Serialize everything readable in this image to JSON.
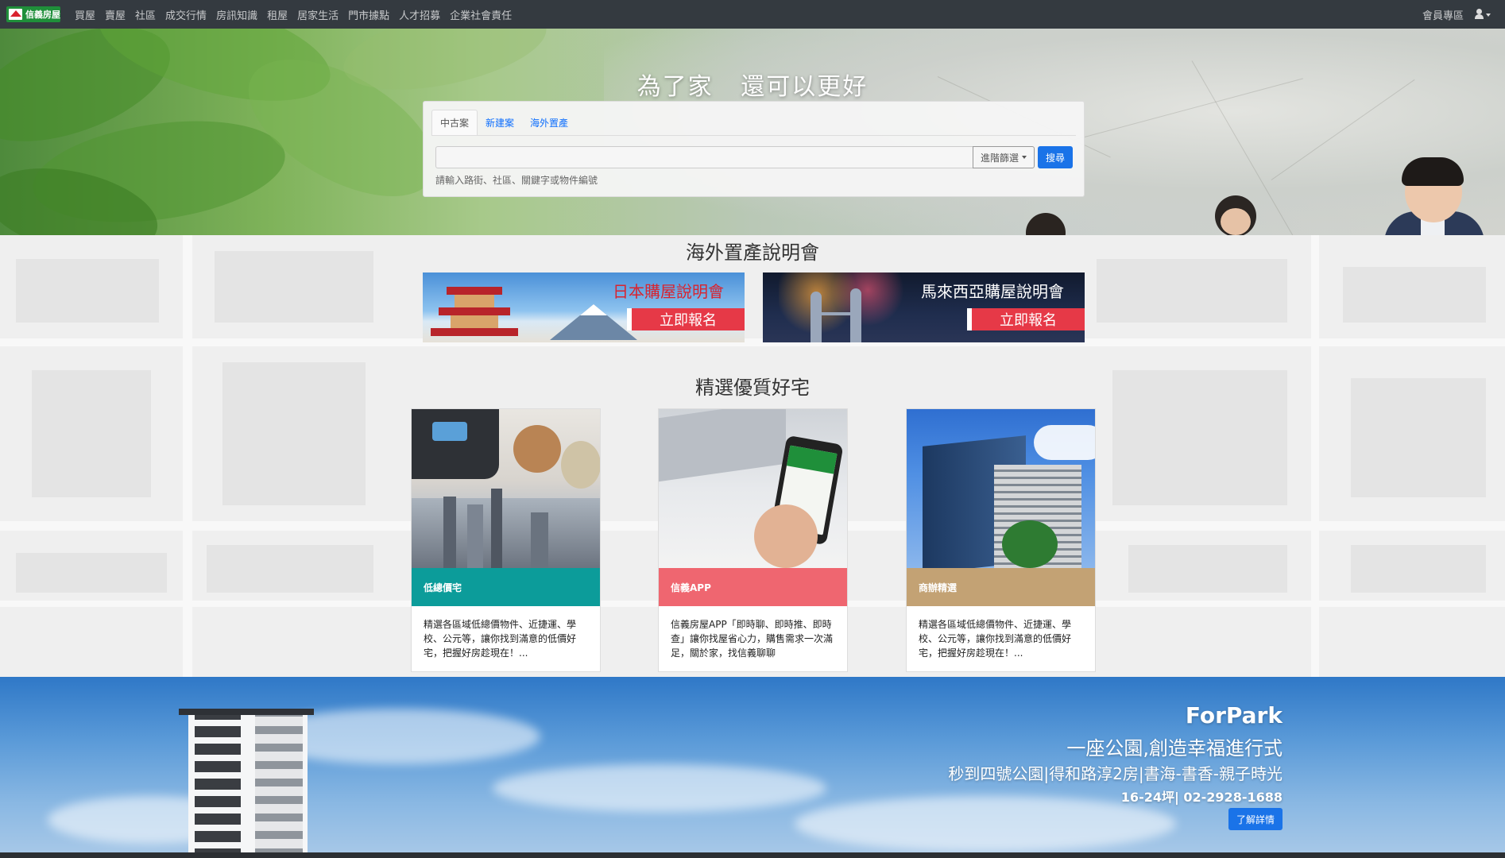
{
  "navbar": {
    "logo_text": "信義房屋",
    "links": [
      "買屋",
      "賣屋",
      "社區",
      "成交行情",
      "房訊知識",
      "租屋",
      "居家生活",
      "門市據點",
      "人才招募",
      "企業社會責任"
    ],
    "member_label": "會員專區",
    "user_icon": "user-icon"
  },
  "hero": {
    "title": "為了家   還可以更好",
    "tabs": [
      "中古案",
      "新建案",
      "海外置產"
    ],
    "active_tab": "中古案",
    "search_value": "",
    "search_placeholder": "",
    "advanced_filter_label": "進階篩選",
    "search_button_label": "搜尋",
    "search_hint": "請輸入路街、社區、關鍵字或物件編號"
  },
  "overseas": {
    "title": "海外置產說明會",
    "banners": [
      {
        "title": "日本購屋說明會",
        "button": "立即報名"
      },
      {
        "title": "馬來西亞購屋說明會",
        "button": "立即報名"
      }
    ]
  },
  "featured": {
    "title": "精選優質好宅",
    "cards": [
      {
        "label": "低總價宅",
        "label_color": "#0c9c9a",
        "text": "精選各區域低總價物件、近捷運、學校、公元等，讓你找到滿意的低價好宅，把握好房趁現在！..."
      },
      {
        "label": "信義APP",
        "label_color": "#ef6670",
        "text": "信義房屋APP「即時聊、即時推、即時查」讓你找屋省心力，購售需求一次滿足，關於家，找信義聊聊"
      },
      {
        "label": "商辦精選",
        "label_color": "#c3a274",
        "text": "精選各區域低總價物件、近捷運、學校、公元等，讓你找到滿意的低價好宅，把握好房趁現在！..."
      }
    ]
  },
  "forpark": {
    "title": "ForPark",
    "subtitle": "一座公園,創造幸福進行式",
    "subtitle2": "秒到四號公園|得和路淳2房|書海-書香-親子時光",
    "contact": "16-24坪| 02-2928-1688",
    "button": "了解詳情"
  },
  "colors": {
    "primary": "#1a73e8",
    "navbar": "#343a40",
    "banner_button": "#e63947"
  }
}
